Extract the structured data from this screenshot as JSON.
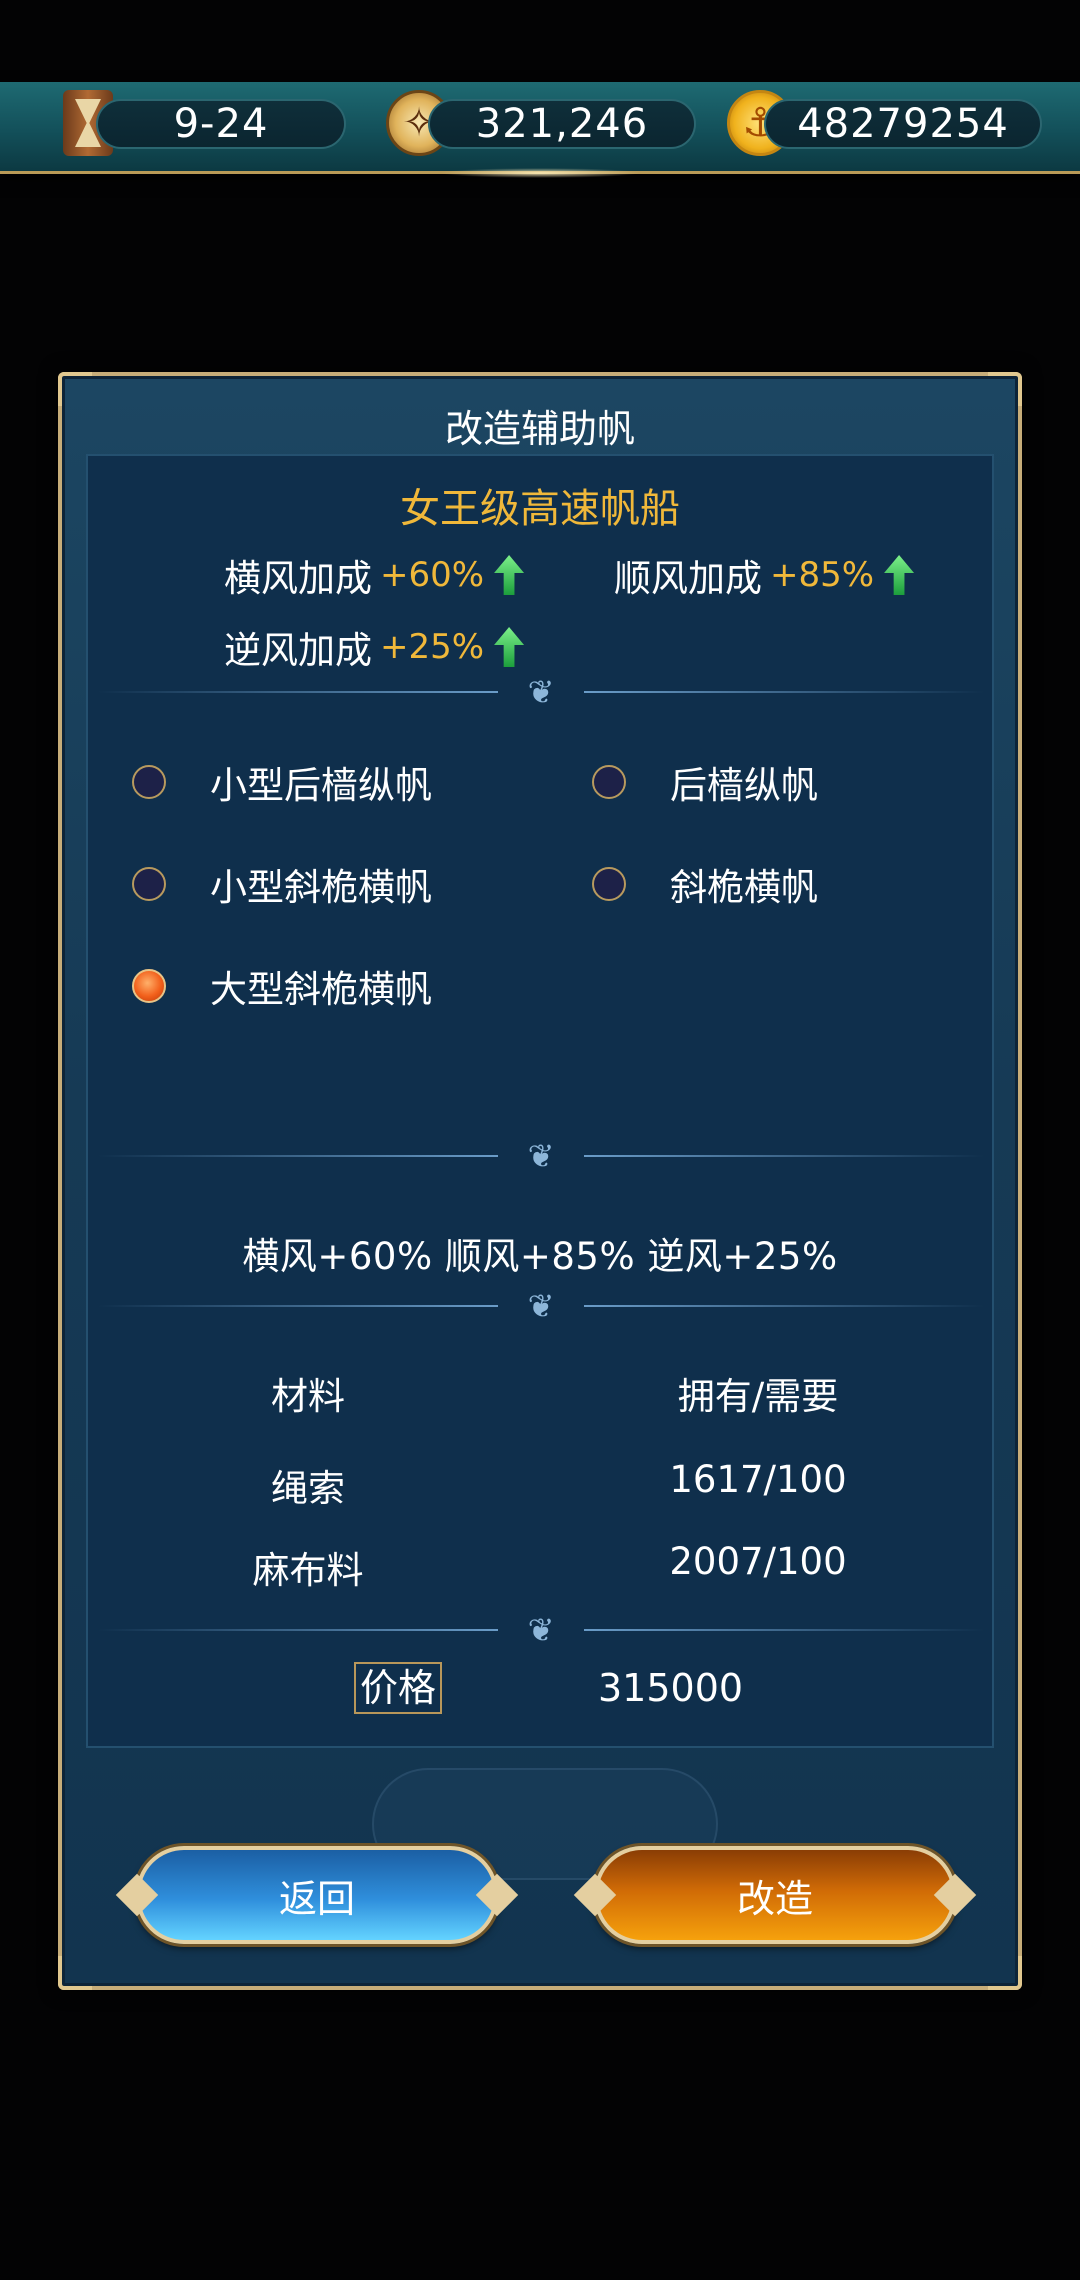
{
  "resources": {
    "stage": "9-24",
    "compass_count": "321,246",
    "gold": "48279254",
    "icons": [
      "hourglass-icon",
      "compass-icon",
      "anchor-coin-icon"
    ]
  },
  "dialog": {
    "title": "改造辅助帆",
    "ship_name": "女王级高速帆船",
    "bonuses": [
      {
        "label": "横风加成",
        "value": "+60%"
      },
      {
        "label": "顺风加成",
        "value": "+85%"
      },
      {
        "label": "逆风加成",
        "value": "+25%"
      }
    ],
    "options": [
      {
        "label": "小型后樯纵帆",
        "selected": false
      },
      {
        "label": "后樯纵帆",
        "selected": false
      },
      {
        "label": "小型斜桅横帆",
        "selected": false
      },
      {
        "label": "斜桅横帆",
        "selected": false
      },
      {
        "label": "大型斜桅横帆",
        "selected": true
      }
    ],
    "summary": "横风+60%  顺风+85%  逆风+25%",
    "materials": {
      "header_material": "材料",
      "header_have_need": "拥有/需要",
      "rows": [
        {
          "name": "绳索",
          "amount": "1617/100"
        },
        {
          "name": "麻布料",
          "amount": "2007/100"
        }
      ]
    },
    "price_label": "价格",
    "price_value": "315000",
    "buttons": {
      "back": "返回",
      "modify": "改造"
    }
  },
  "colors": {
    "accent_gold": "#f0b83a",
    "back_button": "#2f8fdc",
    "modify_button": "#d06b06",
    "selected_radio": "#f2601b"
  }
}
